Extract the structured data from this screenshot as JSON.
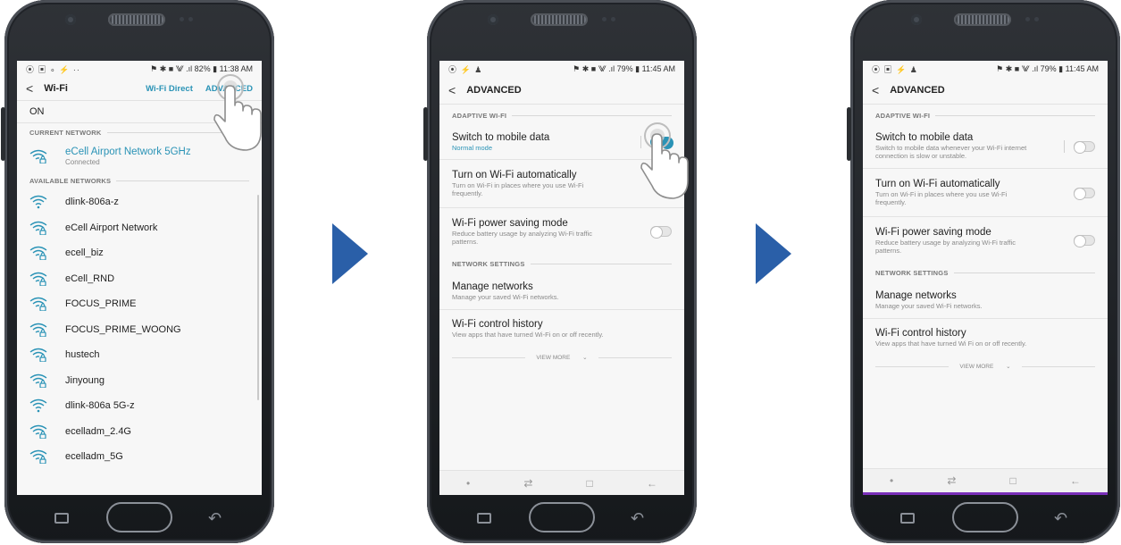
{
  "colors": {
    "accent": "#2a93b6",
    "arrow": "#2a5fa8",
    "bezel": "#1f2226"
  },
  "screen1": {
    "status": {
      "left_icons": "⦿ ▣ ∘ ⚡ ··",
      "right": "⚑ ✱ ■ ⨈ .ıl 82% ▮ 11:38 AM"
    },
    "title": "Wi-Fi",
    "wifi_direct": "Wi-Fi Direct",
    "advanced": "ADVANCED",
    "on_label": "ON",
    "current_header": "CURRENT NETWORK",
    "current": {
      "name": "eCell Airport Network 5GHz",
      "status": "Connected"
    },
    "available_header": "AVAILABLE NETWORKS",
    "networks": [
      {
        "name": "dlink-806a-z",
        "icon": "wifi-open-icon"
      },
      {
        "name": "eCell Airport Network",
        "icon": "wifi-locked-icon"
      },
      {
        "name": "ecell_biz",
        "icon": "wifi-locked-icon"
      },
      {
        "name": "eCell_RND",
        "icon": "wifi-locked-icon"
      },
      {
        "name": "FOCUS_PRIME",
        "icon": "wifi-locked-icon"
      },
      {
        "name": "FOCUS_PRIME_WOONG",
        "icon": "wifi-locked-icon"
      },
      {
        "name": "hustech",
        "icon": "wifi-locked-icon"
      },
      {
        "name": "Jinyoung",
        "icon": "wifi-locked-icon"
      },
      {
        "name": "dlink-806a 5G-z",
        "icon": "wifi-open-icon"
      },
      {
        "name": "ecelladm_2.4G",
        "icon": "wifi-locked-icon"
      },
      {
        "name": "ecelladm_5G",
        "icon": "wifi-locked-icon"
      }
    ]
  },
  "screen2": {
    "status": {
      "left_icons": "⦿ ⚡ ♟",
      "right": "⚑ ✱ ■ ⨈ .ıl 79% ▮ 11:45 AM"
    },
    "title": "ADVANCED",
    "adaptive_header": "ADAPTIVE WI-FI",
    "switch_title": "Switch to mobile data",
    "switch_desc": "Normal mode",
    "turn_on_title": "Turn on Wi-Fi automatically",
    "turn_on_desc": "Turn on Wi-Fi in places where you use Wi-Fi frequently.",
    "power_title": "Wi-Fi power saving mode",
    "power_desc": "Reduce battery usage by analyzing Wi-Fi traffic patterns.",
    "network_header": "NETWORK SETTINGS",
    "manage_title": "Manage networks",
    "manage_desc": "Manage your saved Wi-Fi networks.",
    "history_title": "Wi-Fi control history",
    "history_desc": "View apps that have turned Wi-Fi on or off recently.",
    "view_more": "VIEW MORE"
  },
  "screen3": {
    "status": {
      "left_icons": "⦿ ▣ ⚡ ♟",
      "right": "⚑ ✱ ■ ⨈ .ıl 79% ▮ 11:45 AM"
    },
    "title": "ADVANCED",
    "adaptive_header": "ADAPTIVE WI-FI",
    "switch_title": "Switch to mobile data",
    "switch_desc": "Switch to mobile data whenever your Wi-Fi internet connection is slow or unstable.",
    "turn_on_title": "Turn on Wi-Fi automatically",
    "turn_on_desc": "Turn on Wi-Fi in places where you use Wi-Fi frequently.",
    "power_title": "Wi-Fi power saving mode",
    "power_desc": "Reduce battery usage by analyzing Wi-Fi traffic patterns.",
    "network_header": "NETWORK SETTINGS",
    "manage_title": "Manage networks",
    "manage_desc": "Manage your saved Wi-Fi networks.",
    "history_title": "Wi-Fi control history",
    "history_desc": "View apps that have turned Wi Fi on or off recently.",
    "view_more": "VIEW MORE"
  },
  "softnav": {
    "dot": "•",
    "recents": "⇄",
    "home": "□",
    "back": "←"
  },
  "hw_back": "↶"
}
